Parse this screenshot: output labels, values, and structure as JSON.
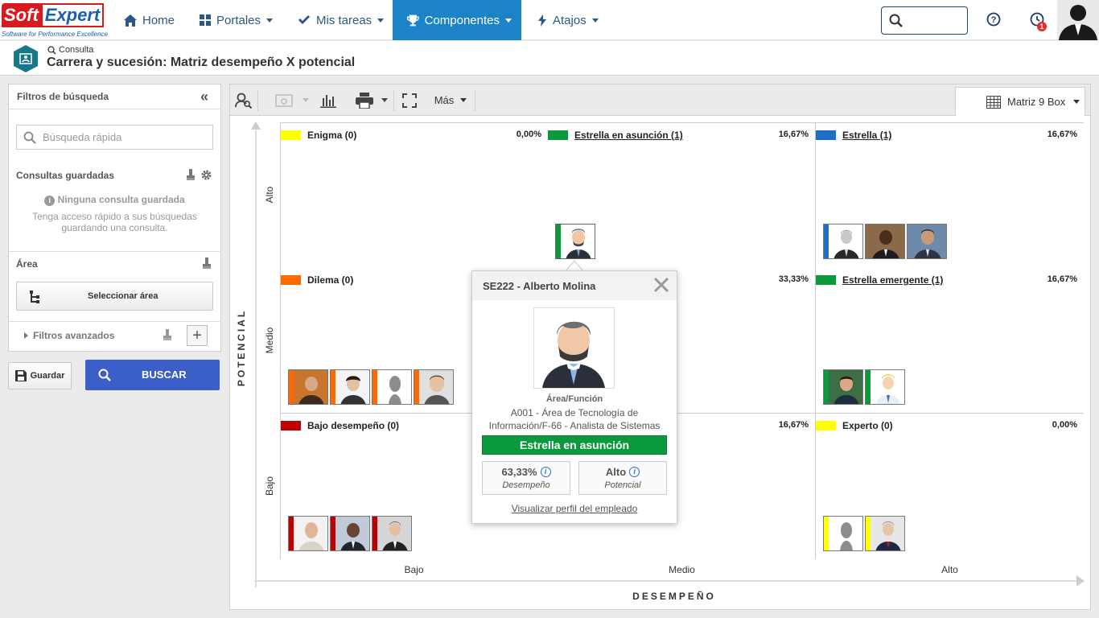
{
  "brand": {
    "logo_part1": "Soft",
    "logo_part2": "Expert",
    "tagline": "Software for Performance Excellence"
  },
  "nav": {
    "items": [
      {
        "label": "Home",
        "icon": "home-icon"
      },
      {
        "label": "Portales",
        "icon": "grid-icon"
      },
      {
        "label": "Mis tareas",
        "icon": "check-icon"
      },
      {
        "label": "Componentes",
        "icon": "trophy-icon"
      },
      {
        "label": "Atajos",
        "icon": "bolt-icon"
      }
    ],
    "active": "Componentes",
    "notification_count": "1"
  },
  "header": {
    "breadcrumb": "Consulta",
    "title": "Carrera y sucesión: Matriz desempeño X potencial"
  },
  "left_panel": {
    "title": "Filtros de búsqueda",
    "quick_search_placeholder": "Búsqueda rápida",
    "saved_queries_title": "Consultas guardadas",
    "no_saved_title": "Ninguna consulta guardada",
    "no_saved_text": "Tenga acceso rápido a sus búsquedas guardando una consulta.",
    "area_title": "Área",
    "select_area_label": "Seleccionar área",
    "advanced_filters_label": "Filtros avanzados",
    "save_label": "Guardar",
    "search_label": "BUSCAR"
  },
  "toolbar": {
    "more_label": "Más",
    "view_label": "Matriz 9 Box"
  },
  "matrix": {
    "y_axis_title": "POTENCIAL",
    "x_axis_title": "DESEMPEÑO",
    "y_levels": [
      "Alto",
      "Medio",
      "Bajo"
    ],
    "x_levels": [
      "Bajo",
      "Medio",
      "Alto"
    ],
    "cells": [
      {
        "label": "Enigma (0)",
        "pct": "0,00%",
        "color": "#ffff00",
        "link": false
      },
      {
        "label": "Estrella en asunción (1)",
        "pct": "16,67%",
        "color": "#0a9a3c",
        "link": true
      },
      {
        "label": "Estrella (1)",
        "pct": "16,67%",
        "color": "#1d6fc4",
        "link": true
      },
      {
        "label": "Dilema (0)",
        "pct": "",
        "color": "#ff6a00",
        "link": false
      },
      {
        "label": "",
        "pct": "33,33%",
        "color": "",
        "link": false
      },
      {
        "label": "Estrella emergente (1)",
        "pct": "16,67%",
        "color": "#0a9a3c",
        "link": true
      },
      {
        "label": "Bajo desempeño (0)",
        "pct": "",
        "color": "#c00000",
        "link": false
      },
      {
        "label": "",
        "pct": "16,67%",
        "color": "",
        "link": false
      },
      {
        "label": "Experto (0)",
        "pct": "0,00%",
        "color": "#ffff00",
        "link": false
      }
    ]
  },
  "popup": {
    "name": "SE222 - Alberto Molina",
    "area_label": "Área/Función",
    "area_value": "A001 - Área de Tecnología de Información/F-66 - Analista de Sistemas",
    "status": "Estrella en asunción",
    "status_color": "#0a9a3c",
    "performance_value": "63,33%",
    "performance_label": "Desempeño",
    "potential_value": "Alto",
    "potential_label": "Potencial",
    "profile_link": "Visualizar perfil del empleado"
  }
}
